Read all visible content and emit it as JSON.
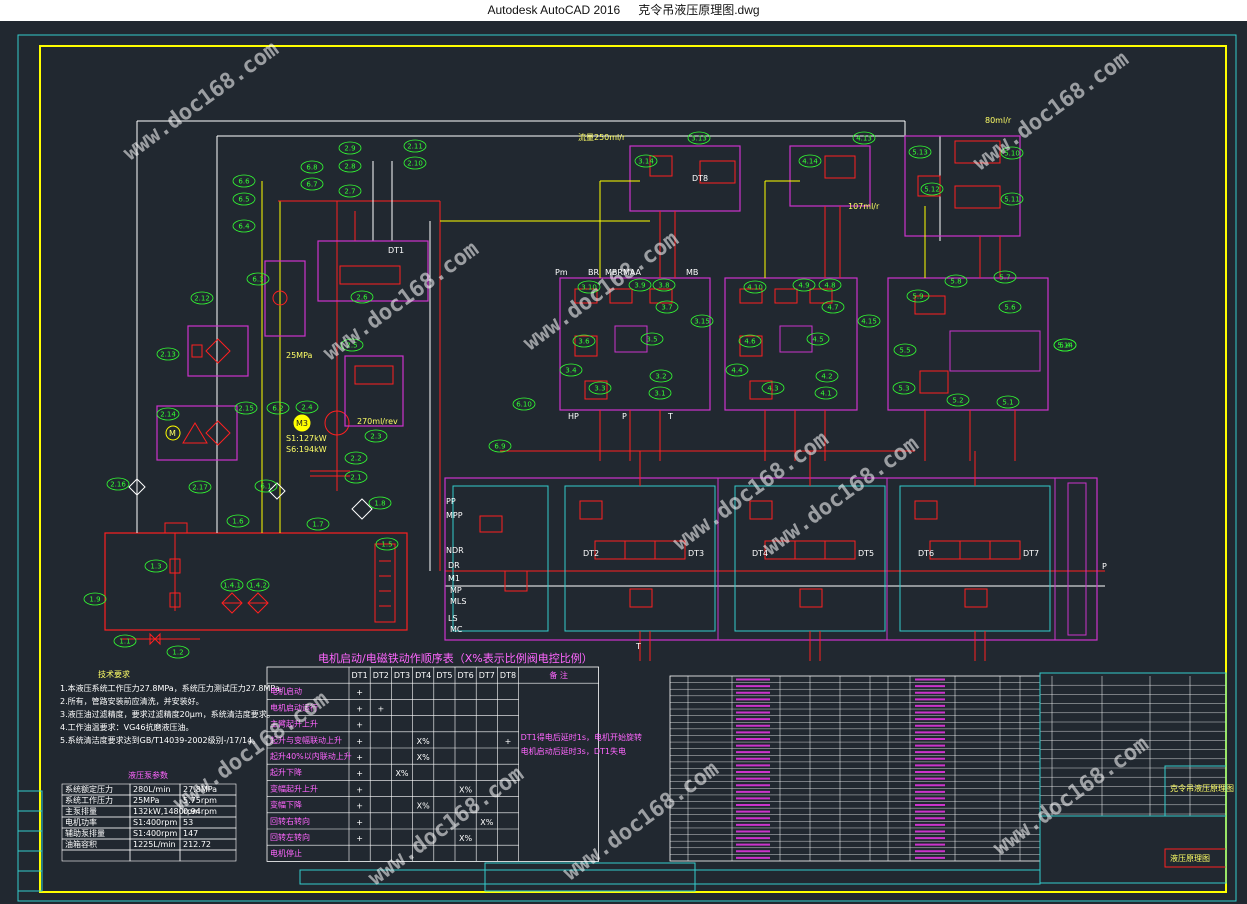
{
  "window": {
    "app": "Autodesk AutoCAD 2016",
    "file": "克令吊液压原理图.dwg"
  },
  "watermark": "www.doc168.com",
  "colors": {
    "background": "#212830",
    "frame": "#ffff00",
    "border": "#33cccc",
    "line_red": "#ff2020",
    "line_yellow": "#ffff00",
    "line_magenta": "#cc33cc",
    "label_green": "#33ff33"
  },
  "labels": {
    "circle_tags": [
      "6.6",
      "6.5",
      "6.4",
      "6.3",
      "6.2",
      "6.1",
      "6.7",
      "6.8",
      "2.12",
      "2.13",
      "2.14",
      "2.15",
      "2.16",
      "2.17",
      "2.9",
      "2.8",
      "2.7",
      "2.11",
      "2.10",
      "2.6",
      "2.5",
      "2.4",
      "2.3",
      "2.2",
      "2.1",
      "1.3",
      "1.4.1",
      "1.4.2",
      "1.5",
      "1.6",
      "1.7",
      "1.8",
      "1.9",
      "1.1",
      "1.2",
      "3.14",
      "3.13",
      "3.10",
      "3.9",
      "3.8",
      "3.7",
      "3.6",
      "3.5",
      "3.4",
      "3.3",
      "3.2",
      "3.1",
      "3.15",
      "4.14",
      "4.13",
      "4.10",
      "4.9",
      "4.8",
      "4.7",
      "4.6",
      "4.5",
      "4.4",
      "4.3",
      "4.2",
      "4.1",
      "4.15",
      "5.13",
      "5.12",
      "5.11",
      "5.10",
      "5.9",
      "5.8",
      "5.7",
      "5.6",
      "5.5",
      "5.4",
      "5.3",
      "5.2",
      "5.1",
      "5.14",
      "6.10",
      "6.9"
    ],
    "port_labels": [
      "Pm",
      "BR",
      "MBRMAA",
      "MB",
      "HP",
      "P",
      "T",
      "PP",
      "MPP",
      "NDR",
      "DR",
      "M1",
      "MP",
      "MLS",
      "LS",
      "MC",
      "T",
      "P"
    ],
    "solenoids": [
      "DT1",
      "DT2",
      "DT3",
      "DT4",
      "DT5",
      "DT6",
      "DT7",
      "DT8"
    ],
    "notes": [
      "流量250ml/r",
      "80ml/r",
      "107ml/r",
      "25MPa",
      "S1:127kW",
      "S6:194kW",
      "270ml/rev"
    ]
  },
  "tech": {
    "title": "技术要求",
    "items": [
      "1.本液压系统工作压力27.8MPa，系统压力测试压力27.8MPa。",
      "2.所有，管路安装前应清洗，并安装好。",
      "3.液压油过滤精度，要求过滤精度20μm，系统清洁度要求。",
      "4.工作油温要求：VG46抗磨液压油。",
      "5.系统清洁度要求达到GB/T14039-2002级别-/17/14。"
    ]
  },
  "param_table": {
    "title": "液压泵参数",
    "rows": [
      [
        "系统额定压力",
        "280L/min",
        "27.8MPa"
      ],
      [
        "系统工作压力",
        "25MPa",
        "5.75rpm"
      ],
      [
        "主泵排量",
        "132kW,1480rpm",
        "0.94rpm"
      ],
      [
        "电机功率",
        "S1:400rpm",
        "53"
      ],
      [
        "辅助泵排量",
        "S1:400rpm",
        "147"
      ],
      [
        "油箱容积",
        "1225L/min",
        "212.72"
      ],
      [
        "",
        "",
        ""
      ]
    ]
  },
  "action_table": {
    "title": "电机启动/电磁铁动作顺序表（X%表示比例阀电控比例）",
    "columns": [
      "DT1",
      "DT2",
      "DT3",
      "DT4",
      "DT5",
      "DT6",
      "DT7",
      "DT8"
    ],
    "remark_header": "备 注",
    "remark_lines": [
      "DT1得电后延时1s，电机开始旋转",
      "电机启动后延时3s，DT1失电"
    ],
    "rows": [
      {
        "name": "电机启动",
        "marks": [
          "+",
          "",
          "",
          "",
          "",
          "",
          "",
          ""
        ]
      },
      {
        "name": "电机启动运行",
        "marks": [
          "+",
          "+",
          "",
          "",
          "",
          "",
          "",
          ""
        ]
      },
      {
        "name": "主臂起升上升",
        "marks": [
          "+",
          "",
          "",
          "",
          "",
          "",
          "",
          ""
        ]
      },
      {
        "name": "起升与变幅联动上升",
        "marks": [
          "+",
          "",
          "",
          "X%",
          "",
          "",
          "",
          "+"
        ]
      },
      {
        "name": "起升40%以内联动上升",
        "marks": [
          "+",
          "",
          "",
          "X%",
          "",
          "",
          "",
          ""
        ]
      },
      {
        "name": "起升下降",
        "marks": [
          "+",
          "",
          "X%",
          "",
          "",
          "",
          "",
          ""
        ]
      },
      {
        "name": "变幅起升上升",
        "marks": [
          "+",
          "",
          "",
          "",
          "",
          "X%",
          "",
          ""
        ]
      },
      {
        "name": "变幅下降",
        "marks": [
          "+",
          "",
          "",
          "X%",
          "",
          "",
          "",
          ""
        ]
      },
      {
        "name": "回转右转向",
        "marks": [
          "+",
          "",
          "",
          "",
          "",
          "",
          "X%",
          ""
        ]
      },
      {
        "name": "回转左转向",
        "marks": [
          "+",
          "",
          "",
          "",
          "",
          "X%",
          "",
          ""
        ]
      },
      {
        "name": "电机停止",
        "marks": [
          "",
          "",
          "",
          "",
          "",
          "",
          "",
          ""
        ]
      }
    ]
  },
  "title_block": {
    "project": "克令吊液压原理图",
    "drawing_label": "液压原理图"
  }
}
